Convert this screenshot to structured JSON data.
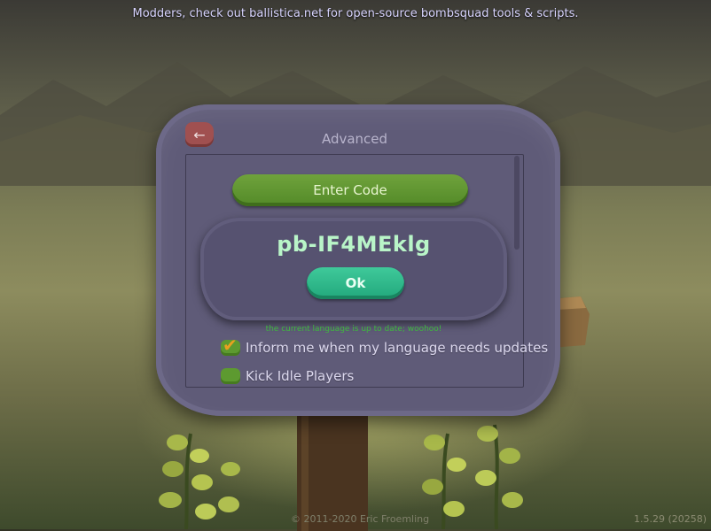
{
  "top_tip": "Modders, check out ballistica.net for open-source bombsquad tools & scripts.",
  "panel": {
    "title": "Advanced",
    "back_icon": "left-arrow-icon"
  },
  "enter_code_button": "Enter Code",
  "code_popup": {
    "code": "pb-IF4MEklg",
    "ok_label": "Ok"
  },
  "language_status": "the current language is up to date; woohoo!",
  "checkboxes": [
    {
      "label": "Inform me when my language needs updates",
      "checked": true
    },
    {
      "label": "Kick Idle Players",
      "checked": false
    }
  ],
  "footer": {
    "copyright": "© 2011-2020 Eric Froemling",
    "version": "1.5.29 (20258)"
  },
  "colors": {
    "panel": "#5f5b78",
    "enter_code": "#6fa23c",
    "ok": "#3fc99a",
    "code_text": "#b9f5c8",
    "status_text": "#3fb83f",
    "back_button": "#a05050"
  }
}
